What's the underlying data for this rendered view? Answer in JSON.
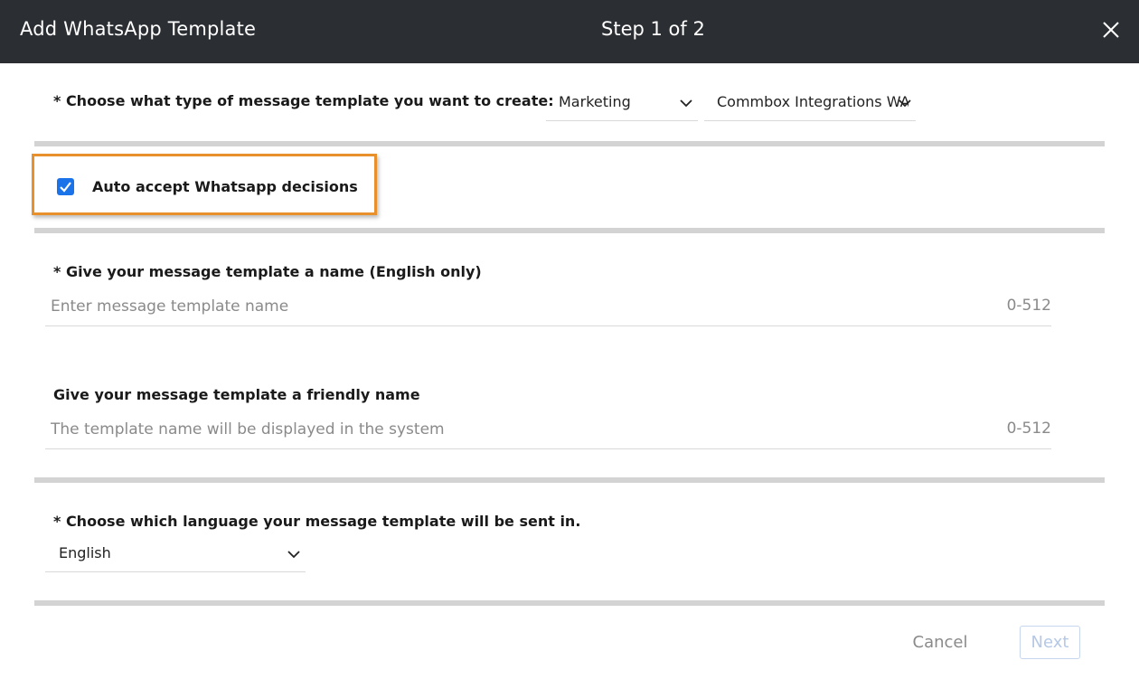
{
  "header": {
    "title": "Add WhatsApp Template",
    "step": "Step 1 of 2",
    "close_icon": "close-icon"
  },
  "type_section": {
    "label": "* Choose what type of message template you want to create:",
    "category_select": {
      "value": "Marketing",
      "icon": "chevron-down-icon"
    },
    "account_select": {
      "value": "Commbox Integrations WA",
      "icon": "chevron-down-icon"
    }
  },
  "auto_accept": {
    "checked": true,
    "label": "Auto accept Whatsapp decisions",
    "highlight_color": "#e8902c"
  },
  "name_section": {
    "label": "* Give your message template a name (English only)",
    "placeholder": "Enter message template name",
    "value": "",
    "counter": "0-512"
  },
  "friendly_name_section": {
    "label": "Give your message template a friendly name",
    "placeholder": "The template name will be displayed in the system",
    "value": "",
    "counter": "0-512"
  },
  "language_section": {
    "label": "* Choose which language your message template will be sent in.",
    "select": {
      "value": "English",
      "icon": "chevron-down-icon"
    }
  },
  "footer": {
    "cancel_label": "Cancel",
    "next_label": "Next"
  },
  "colors": {
    "header_bg": "#2b2e33",
    "checkbox": "#1a73e8",
    "divider": "#d3d3d3",
    "next_disabled": "#b5c8e6"
  }
}
